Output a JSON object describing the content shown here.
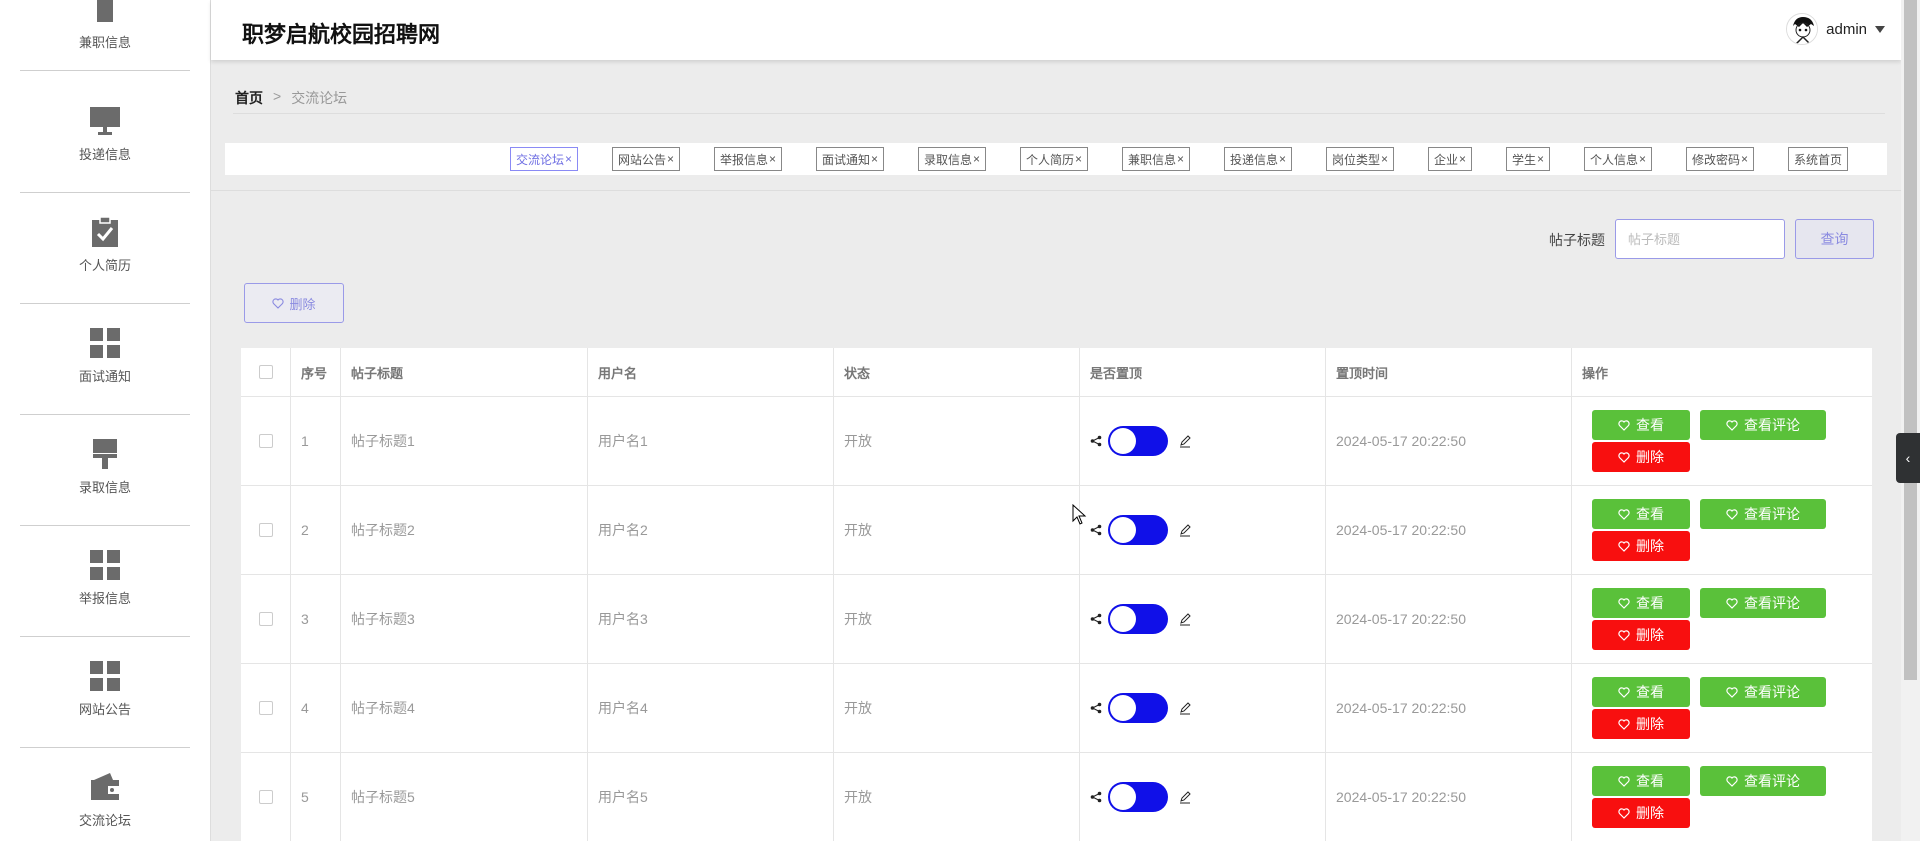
{
  "header": {
    "site_title": "职梦启航校园招聘网",
    "username": "admin"
  },
  "sidebar": {
    "items": [
      {
        "label": "兼职信息",
        "icon": "shirt-icon"
      },
      {
        "label": "投递信息",
        "icon": "monitor-icon"
      },
      {
        "label": "个人简历",
        "icon": "clipboard-check-icon"
      },
      {
        "label": "面试通知",
        "icon": "grid-icon"
      },
      {
        "label": "录取信息",
        "icon": "brush-icon"
      },
      {
        "label": "举报信息",
        "icon": "grid-icon"
      },
      {
        "label": "网站公告",
        "icon": "grid-icon"
      },
      {
        "label": "交流论坛",
        "icon": "wallet-icon"
      }
    ]
  },
  "breadcrumb": {
    "home": "首页",
    "separator": ">",
    "current": "交流论坛"
  },
  "tags": [
    {
      "label": "交流论坛",
      "active": true
    },
    {
      "label": "网站公告"
    },
    {
      "label": "举报信息"
    },
    {
      "label": "面试通知"
    },
    {
      "label": "录取信息"
    },
    {
      "label": "个人简历"
    },
    {
      "label": "兼职信息"
    },
    {
      "label": "投递信息"
    },
    {
      "label": "岗位类型"
    },
    {
      "label": "企业"
    },
    {
      "label": "学生"
    },
    {
      "label": "个人信息"
    },
    {
      "label": "修改密码"
    },
    {
      "label": "系统首页"
    }
  ],
  "tag_close": "×",
  "search": {
    "label": "帖子标题",
    "placeholder": "帖子标题",
    "button": "查询"
  },
  "toolbar": {
    "delete_label": "删除"
  },
  "table": {
    "columns": [
      "序号",
      "帖子标题",
      "用户名",
      "状态",
      "是否置顶",
      "置顶时间",
      "操作"
    ],
    "rows": [
      {
        "index": "1",
        "title": "帖子标题1",
        "user": "用户名1",
        "status": "开放",
        "pinned": true,
        "pin_time": "2024-05-17 20:22:50"
      },
      {
        "index": "2",
        "title": "帖子标题2",
        "user": "用户名2",
        "status": "开放",
        "pinned": true,
        "pin_time": "2024-05-17 20:22:50"
      },
      {
        "index": "3",
        "title": "帖子标题3",
        "user": "用户名3",
        "status": "开放",
        "pinned": true,
        "pin_time": "2024-05-17 20:22:50"
      },
      {
        "index": "4",
        "title": "帖子标题4",
        "user": "用户名4",
        "status": "开放",
        "pinned": true,
        "pin_time": "2024-05-17 20:22:50"
      },
      {
        "index": "5",
        "title": "帖子标题5",
        "user": "用户名5",
        "status": "开放",
        "pinned": true,
        "pin_time": "2024-05-17 20:22:50"
      }
    ],
    "actions": {
      "view": "查看",
      "comments": "查看评论",
      "delete": "删除"
    }
  },
  "colors": {
    "accent": "#8a8af5",
    "toggle_on": "#1010e8",
    "btn_green": "#5ac13a",
    "btn_red": "#f80f0f"
  }
}
